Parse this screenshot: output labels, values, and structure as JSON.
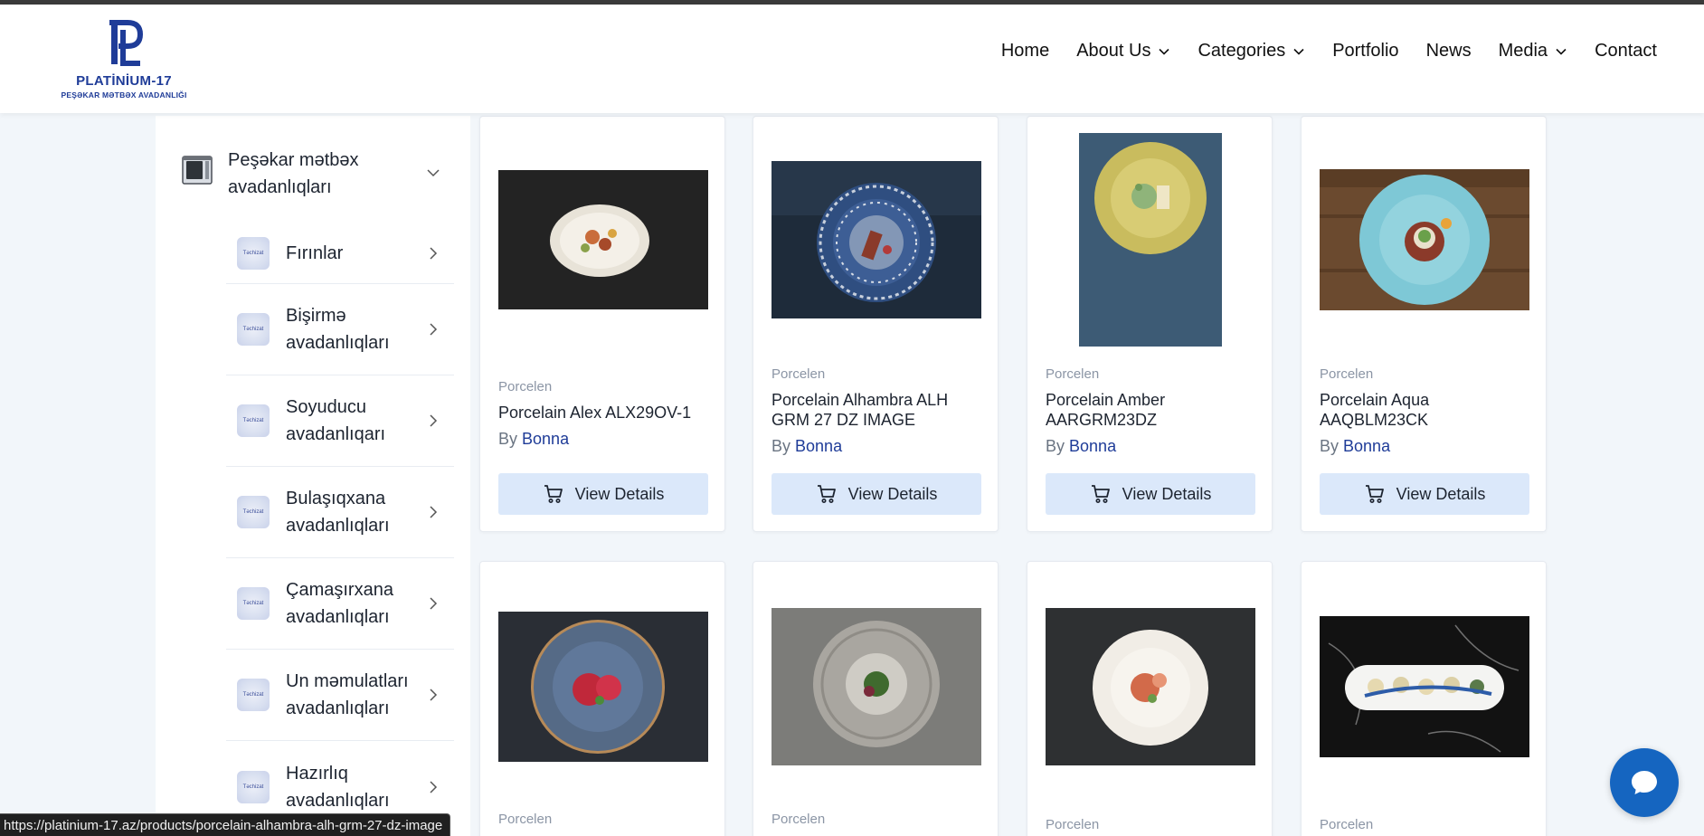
{
  "logo": {
    "name": "PLATİNİUM-17",
    "subtitle": "PEŞƏKAR MƏTBƏX AVADANLIĞI",
    "mark": "PL"
  },
  "nav": {
    "home": "Home",
    "about": "About Us",
    "categories": "Categories",
    "portfolio": "Portfolio",
    "news": "News",
    "media": "Media",
    "contact": "Contact"
  },
  "sidebar": {
    "category": "Peşəkar mətbəx avadanlıqları",
    "thumb_text": "Təchizat",
    "items": [
      {
        "label": "Fırınlar"
      },
      {
        "label": "Bişirmə avadanlıqları"
      },
      {
        "label": "Soyuducu avadanlıqarı"
      },
      {
        "label": "Bulaşıqxana avadanlıqları"
      },
      {
        "label": "Çamaşırxana avadanlıqları"
      },
      {
        "label": "Un məmulatları avadanlıqları"
      },
      {
        "label": "Hazırlıq avadanlıqları"
      }
    ]
  },
  "products": [
    {
      "category": "Porcelen",
      "title": "Porcelain Alex ALX29OV-1",
      "by": "By",
      "brand": "Bonna",
      "button": "View Details"
    },
    {
      "category": "Porcelen",
      "title": "Porcelain Alhambra ALH GRM 27 DZ IMAGE",
      "by": "By",
      "brand": "Bonna",
      "button": "View Details"
    },
    {
      "category": "Porcelen",
      "title": "Porcelain Amber AARGRM23DZ",
      "by": "By",
      "brand": "Bonna",
      "button": "View Details"
    },
    {
      "category": "Porcelen",
      "title": "Porcelain Aqua AAQBLM23CK",
      "by": "By",
      "brand": "Bonna",
      "button": "View Details"
    },
    {
      "category": "Porcelen"
    },
    {
      "category": "Porcelen"
    },
    {
      "category": "Porcelen"
    },
    {
      "category": "Porcelen"
    }
  ],
  "status_url": "https://platinium-17.az/products/porcelain-alhambra-alh-grm-27-dz-image",
  "colors": {
    "brand": "#1f3c98",
    "button_bg": "#dbe8fa",
    "chat": "#1565c0"
  },
  "icons": [
    "chevron-down-icon",
    "chevron-right-icon",
    "cart-icon",
    "chat-icon",
    "oven-icon"
  ]
}
